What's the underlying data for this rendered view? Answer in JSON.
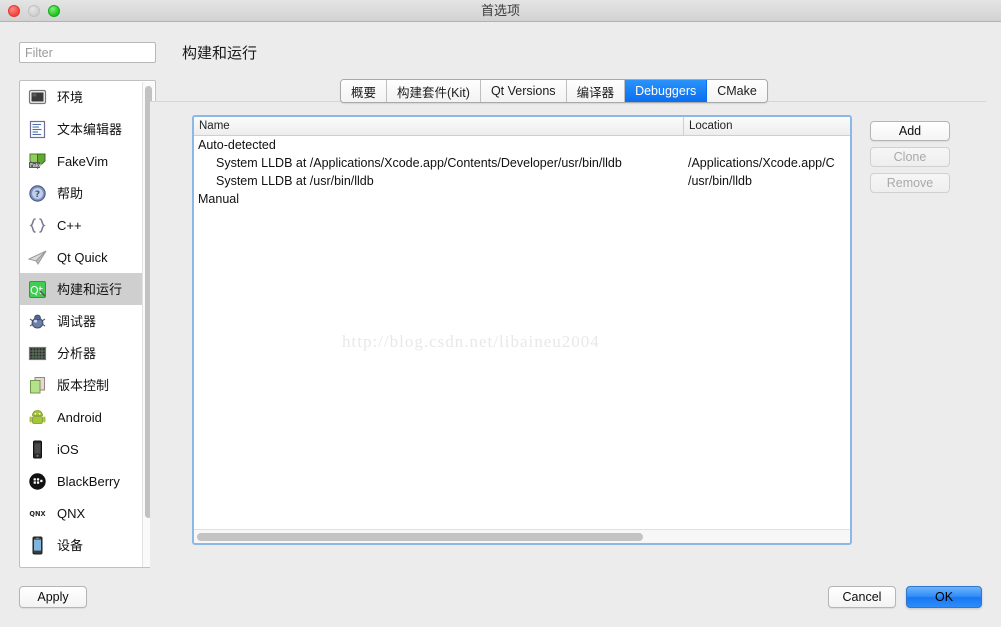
{
  "window": {
    "title": "首选项"
  },
  "traffic_lights": {
    "close": "close-button",
    "minimize": "minimize-button",
    "maximize": "maximize-button"
  },
  "filter": {
    "placeholder": "Filter",
    "value": ""
  },
  "sidebar": {
    "items": [
      {
        "label": "环境",
        "icon": "monitor-icon"
      },
      {
        "label": "文本编辑器",
        "icon": "text-editor-icon"
      },
      {
        "label": "FakeVim",
        "icon": "fakevim-icon"
      },
      {
        "label": "帮助",
        "icon": "help-icon"
      },
      {
        "label": "C++",
        "icon": "braces-icon"
      },
      {
        "label": "Qt Quick",
        "icon": "paper-plane-icon"
      },
      {
        "label": "构建和运行",
        "icon": "qt-build-run-icon",
        "selected": true
      },
      {
        "label": "调试器",
        "icon": "bug-icon"
      },
      {
        "label": "分析器",
        "icon": "analyzer-icon"
      },
      {
        "label": "版本控制",
        "icon": "version-control-icon"
      },
      {
        "label": "Android",
        "icon": "android-icon"
      },
      {
        "label": "iOS",
        "icon": "iphone-icon"
      },
      {
        "label": "BlackBerry",
        "icon": "blackberry-icon"
      },
      {
        "label": "QNX",
        "icon": "qnx-icon"
      },
      {
        "label": "设备",
        "icon": "device-icon"
      }
    ]
  },
  "page": {
    "title": "构建和运行"
  },
  "tabs": [
    {
      "label": "概要",
      "active": false
    },
    {
      "label": "构建套件(Kit)",
      "active": false
    },
    {
      "label": "Qt Versions",
      "active": false
    },
    {
      "label": "编译器",
      "active": false
    },
    {
      "label": "Debuggers",
      "active": true
    },
    {
      "label": "CMake",
      "active": false
    }
  ],
  "table": {
    "columns": [
      "Name",
      "Location"
    ],
    "rows": [
      {
        "name": "Auto-detected",
        "location": "",
        "group": true
      },
      {
        "name": "System LLDB at /Applications/Xcode.app/Contents/Developer/usr/bin/lldb",
        "location": "/Applications/Xcode.app/C",
        "group": false
      },
      {
        "name": "System LLDB at /usr/bin/lldb",
        "location": "/usr/bin/lldb",
        "group": false
      },
      {
        "name": "Manual",
        "location": "",
        "group": true
      }
    ]
  },
  "watermark": {
    "text": "http://blog.csdn.net/libaineu2004"
  },
  "side_buttons": [
    {
      "label": "Add",
      "disabled": false
    },
    {
      "label": "Clone",
      "disabled": true
    },
    {
      "label": "Remove",
      "disabled": true
    }
  ],
  "footer": {
    "apply_label": "Apply",
    "cancel_label": "Cancel",
    "ok_label": "OK"
  },
  "colors": {
    "accent_blue": "#0a6ef0",
    "tab_active_blue": "#2a93fb",
    "focus_border": "#8cb8e8",
    "window_bg": "#ececec",
    "disabled_text": "#a9a9a9"
  }
}
